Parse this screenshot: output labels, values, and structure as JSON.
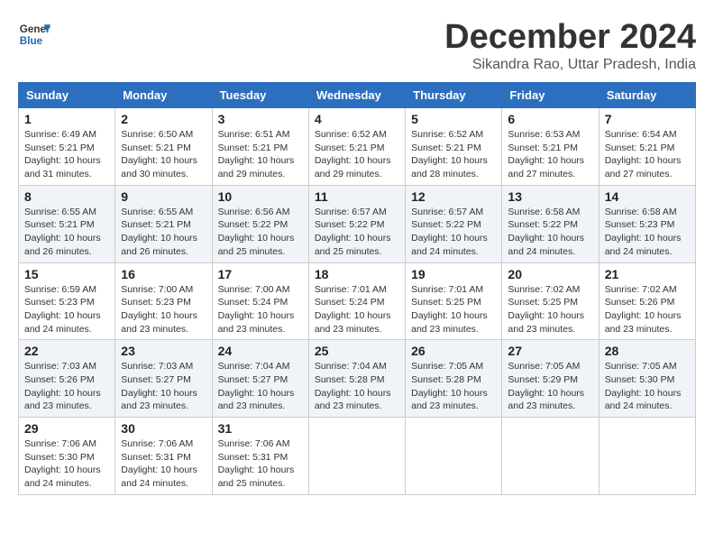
{
  "logo": {
    "line1": "General",
    "line2": "Blue"
  },
  "title": "December 2024",
  "location": "Sikandra Rao, Uttar Pradesh, India",
  "headers": [
    "Sunday",
    "Monday",
    "Tuesday",
    "Wednesday",
    "Thursday",
    "Friday",
    "Saturday"
  ],
  "weeks": [
    [
      {
        "day": "1",
        "sunrise": "Sunrise: 6:49 AM",
        "sunset": "Sunset: 5:21 PM",
        "daylight": "Daylight: 10 hours and 31 minutes."
      },
      {
        "day": "2",
        "sunrise": "Sunrise: 6:50 AM",
        "sunset": "Sunset: 5:21 PM",
        "daylight": "Daylight: 10 hours and 30 minutes."
      },
      {
        "day": "3",
        "sunrise": "Sunrise: 6:51 AM",
        "sunset": "Sunset: 5:21 PM",
        "daylight": "Daylight: 10 hours and 29 minutes."
      },
      {
        "day": "4",
        "sunrise": "Sunrise: 6:52 AM",
        "sunset": "Sunset: 5:21 PM",
        "daylight": "Daylight: 10 hours and 29 minutes."
      },
      {
        "day": "5",
        "sunrise": "Sunrise: 6:52 AM",
        "sunset": "Sunset: 5:21 PM",
        "daylight": "Daylight: 10 hours and 28 minutes."
      },
      {
        "day": "6",
        "sunrise": "Sunrise: 6:53 AM",
        "sunset": "Sunset: 5:21 PM",
        "daylight": "Daylight: 10 hours and 27 minutes."
      },
      {
        "day": "7",
        "sunrise": "Sunrise: 6:54 AM",
        "sunset": "Sunset: 5:21 PM",
        "daylight": "Daylight: 10 hours and 27 minutes."
      }
    ],
    [
      {
        "day": "8",
        "sunrise": "Sunrise: 6:55 AM",
        "sunset": "Sunset: 5:21 PM",
        "daylight": "Daylight: 10 hours and 26 minutes."
      },
      {
        "day": "9",
        "sunrise": "Sunrise: 6:55 AM",
        "sunset": "Sunset: 5:21 PM",
        "daylight": "Daylight: 10 hours and 26 minutes."
      },
      {
        "day": "10",
        "sunrise": "Sunrise: 6:56 AM",
        "sunset": "Sunset: 5:22 PM",
        "daylight": "Daylight: 10 hours and 25 minutes."
      },
      {
        "day": "11",
        "sunrise": "Sunrise: 6:57 AM",
        "sunset": "Sunset: 5:22 PM",
        "daylight": "Daylight: 10 hours and 25 minutes."
      },
      {
        "day": "12",
        "sunrise": "Sunrise: 6:57 AM",
        "sunset": "Sunset: 5:22 PM",
        "daylight": "Daylight: 10 hours and 24 minutes."
      },
      {
        "day": "13",
        "sunrise": "Sunrise: 6:58 AM",
        "sunset": "Sunset: 5:22 PM",
        "daylight": "Daylight: 10 hours and 24 minutes."
      },
      {
        "day": "14",
        "sunrise": "Sunrise: 6:58 AM",
        "sunset": "Sunset: 5:23 PM",
        "daylight": "Daylight: 10 hours and 24 minutes."
      }
    ],
    [
      {
        "day": "15",
        "sunrise": "Sunrise: 6:59 AM",
        "sunset": "Sunset: 5:23 PM",
        "daylight": "Daylight: 10 hours and 24 minutes."
      },
      {
        "day": "16",
        "sunrise": "Sunrise: 7:00 AM",
        "sunset": "Sunset: 5:23 PM",
        "daylight": "Daylight: 10 hours and 23 minutes."
      },
      {
        "day": "17",
        "sunrise": "Sunrise: 7:00 AM",
        "sunset": "Sunset: 5:24 PM",
        "daylight": "Daylight: 10 hours and 23 minutes."
      },
      {
        "day": "18",
        "sunrise": "Sunrise: 7:01 AM",
        "sunset": "Sunset: 5:24 PM",
        "daylight": "Daylight: 10 hours and 23 minutes."
      },
      {
        "day": "19",
        "sunrise": "Sunrise: 7:01 AM",
        "sunset": "Sunset: 5:25 PM",
        "daylight": "Daylight: 10 hours and 23 minutes."
      },
      {
        "day": "20",
        "sunrise": "Sunrise: 7:02 AM",
        "sunset": "Sunset: 5:25 PM",
        "daylight": "Daylight: 10 hours and 23 minutes."
      },
      {
        "day": "21",
        "sunrise": "Sunrise: 7:02 AM",
        "sunset": "Sunset: 5:26 PM",
        "daylight": "Daylight: 10 hours and 23 minutes."
      }
    ],
    [
      {
        "day": "22",
        "sunrise": "Sunrise: 7:03 AM",
        "sunset": "Sunset: 5:26 PM",
        "daylight": "Daylight: 10 hours and 23 minutes."
      },
      {
        "day": "23",
        "sunrise": "Sunrise: 7:03 AM",
        "sunset": "Sunset: 5:27 PM",
        "daylight": "Daylight: 10 hours and 23 minutes."
      },
      {
        "day": "24",
        "sunrise": "Sunrise: 7:04 AM",
        "sunset": "Sunset: 5:27 PM",
        "daylight": "Daylight: 10 hours and 23 minutes."
      },
      {
        "day": "25",
        "sunrise": "Sunrise: 7:04 AM",
        "sunset": "Sunset: 5:28 PM",
        "daylight": "Daylight: 10 hours and 23 minutes."
      },
      {
        "day": "26",
        "sunrise": "Sunrise: 7:05 AM",
        "sunset": "Sunset: 5:28 PM",
        "daylight": "Daylight: 10 hours and 23 minutes."
      },
      {
        "day": "27",
        "sunrise": "Sunrise: 7:05 AM",
        "sunset": "Sunset: 5:29 PM",
        "daylight": "Daylight: 10 hours and 23 minutes."
      },
      {
        "day": "28",
        "sunrise": "Sunrise: 7:05 AM",
        "sunset": "Sunset: 5:30 PM",
        "daylight": "Daylight: 10 hours and 24 minutes."
      }
    ],
    [
      {
        "day": "29",
        "sunrise": "Sunrise: 7:06 AM",
        "sunset": "Sunset: 5:30 PM",
        "daylight": "Daylight: 10 hours and 24 minutes."
      },
      {
        "day": "30",
        "sunrise": "Sunrise: 7:06 AM",
        "sunset": "Sunset: 5:31 PM",
        "daylight": "Daylight: 10 hours and 24 minutes."
      },
      {
        "day": "31",
        "sunrise": "Sunrise: 7:06 AM",
        "sunset": "Sunset: 5:31 PM",
        "daylight": "Daylight: 10 hours and 25 minutes."
      },
      null,
      null,
      null,
      null
    ]
  ]
}
